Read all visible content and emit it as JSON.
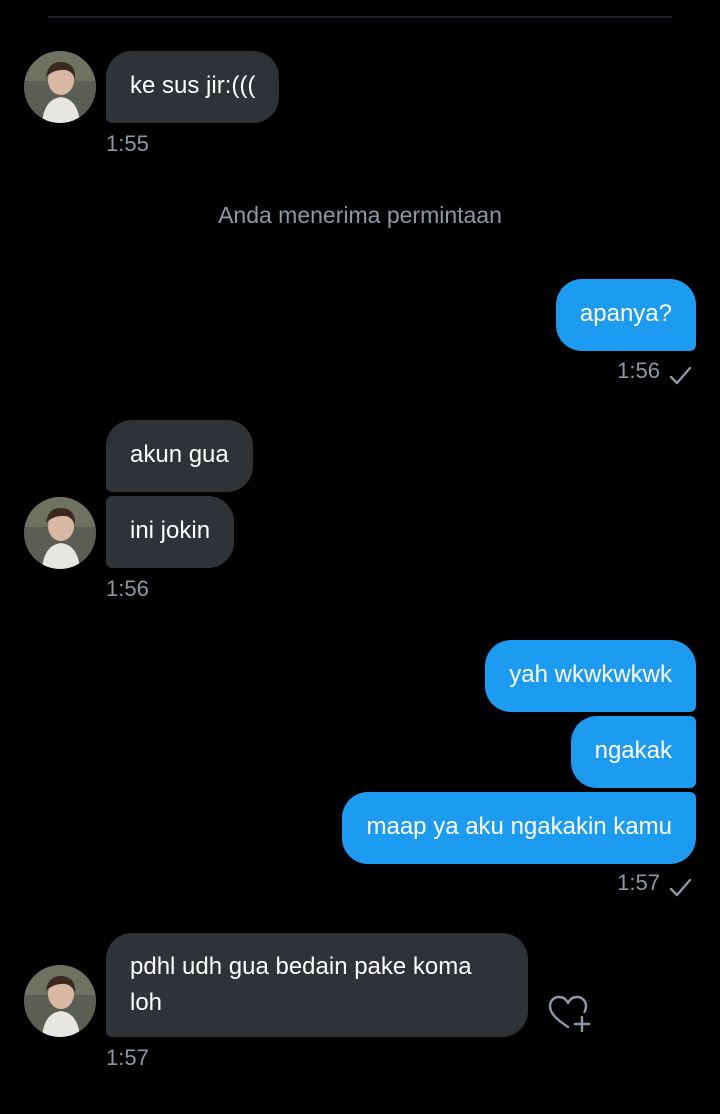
{
  "messages": [
    {
      "text": "ke sus jir:(((",
      "time": "1:55"
    },
    {
      "system": "Anda menerima permintaan"
    },
    {
      "text": "apanya?",
      "time": "1:56"
    },
    {
      "text": "akun gua"
    },
    {
      "text": "ini jokin",
      "time": "1:56"
    },
    {
      "text": "yah wkwkwkwk"
    },
    {
      "text": "ngakak"
    },
    {
      "text": "maap ya aku ngakakin kamu",
      "time": "1:57"
    },
    {
      "text": "pdhl udh gua bedain pake koma loh",
      "time": "1:57"
    }
  ],
  "colors": {
    "background": "#000000",
    "incoming_bubble": "#2f3336",
    "outgoing_bubble": "#1d9bf0",
    "muted_text": "#8b98a5"
  },
  "icons": {
    "read_receipt": "check-icon",
    "react": "heart-plus-icon",
    "sender_avatar": "avatar"
  }
}
